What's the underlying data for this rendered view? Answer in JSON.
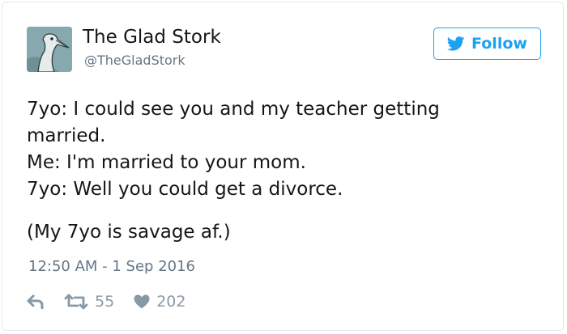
{
  "author": {
    "name": "The Glad Stork",
    "handle": "@TheGladStork"
  },
  "follow_button": {
    "label": "Follow",
    "icon": "twitter-bird-icon"
  },
  "tweet": {
    "lines": [
      "7yo: I could see you and my teacher getting",
      "married.",
      "Me: I'm married to your mom.",
      "7yo: Well you could get a divorce.",
      "(My 7yo is savage af.)"
    ],
    "timestamp": "12:50 AM - 1 Sep 2016"
  },
  "actions": {
    "reply_icon": "reply-icon",
    "retweet_icon": "retweet-icon",
    "retweet_count": "55",
    "like_icon": "heart-icon",
    "like_count": "202"
  },
  "colors": {
    "accent": "#1da1f2",
    "text": "#14171a",
    "muted": "#657786",
    "action": "#8899a6",
    "border": "#e1e8ed"
  }
}
